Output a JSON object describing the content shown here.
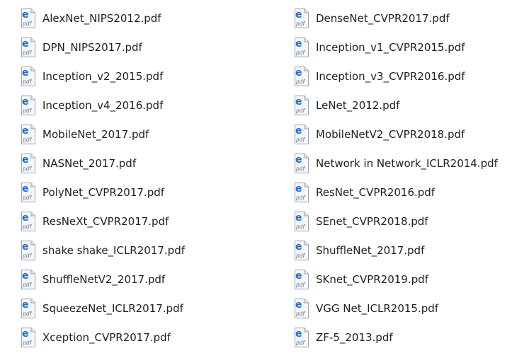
{
  "files": {
    "left": [
      {
        "name": "AlexNet_NIPS2012.pdf",
        "icon": "edge-pdf-file-icon"
      },
      {
        "name": "DPN_NIPS2017.pdf",
        "icon": "edge-pdf-file-icon"
      },
      {
        "name": "Inception_v2_2015.pdf",
        "icon": "edge-pdf-file-icon"
      },
      {
        "name": "Inception_v4_2016.pdf",
        "icon": "edge-pdf-file-icon"
      },
      {
        "name": "MobileNet_2017.pdf",
        "icon": "edge-pdf-file-icon"
      },
      {
        "name": "NASNet_2017.pdf",
        "icon": "edge-pdf-file-icon"
      },
      {
        "name": "PolyNet_CVPR2017.pdf",
        "icon": "edge-pdf-file-icon"
      },
      {
        "name": "ResNeXt_CVPR2017.pdf",
        "icon": "edge-pdf-file-icon"
      },
      {
        "name": "shake shake_ICLR2017.pdf",
        "icon": "edge-pdf-file-icon"
      },
      {
        "name": "ShuffleNetV2_2017.pdf",
        "icon": "edge-pdf-file-icon"
      },
      {
        "name": "SqueezeNet_ICLR2017.pdf",
        "icon": "edge-pdf-file-icon"
      },
      {
        "name": "Xception_CVPR2017.pdf",
        "icon": "edge-pdf-file-icon"
      }
    ],
    "right": [
      {
        "name": "DenseNet_CVPR2017.pdf",
        "icon": "edge-pdf-file-icon"
      },
      {
        "name": "Inception_v1_CVPR2015.pdf",
        "icon": "edge-pdf-file-icon"
      },
      {
        "name": "Inception_v3_CVPR2016.pdf",
        "icon": "edge-pdf-file-icon"
      },
      {
        "name": "LeNet_2012.pdf",
        "icon": "edge-pdf-file-icon"
      },
      {
        "name": "MobileNetV2_CVPR2018.pdf",
        "icon": "edge-pdf-file-icon"
      },
      {
        "name": "Network in Network_ICLR2014.pdf",
        "icon": "edge-pdf-file-icon"
      },
      {
        "name": "ResNet_CVPR2016.pdf",
        "icon": "edge-pdf-file-icon"
      },
      {
        "name": "SEnet_CVPR2018.pdf",
        "icon": "edge-pdf-file-icon"
      },
      {
        "name": "ShuffleNet_2017.pdf",
        "icon": "edge-pdf-file-icon"
      },
      {
        "name": "SKnet_CVPR2019.pdf",
        "icon": "edge-pdf-file-icon"
      },
      {
        "name": "VGG Net_ICLR2015.pdf",
        "icon": "edge-pdf-file-icon"
      },
      {
        "name": "ZF-5_2013.pdf",
        "icon": "edge-pdf-file-icon"
      }
    ]
  },
  "icon_style": {
    "badge_text": "pdf",
    "brand_color": "#1e6fc9",
    "page_color": "#f3f6fa",
    "page_border": "#9aa7b5",
    "badge_color": "#6b7785"
  }
}
